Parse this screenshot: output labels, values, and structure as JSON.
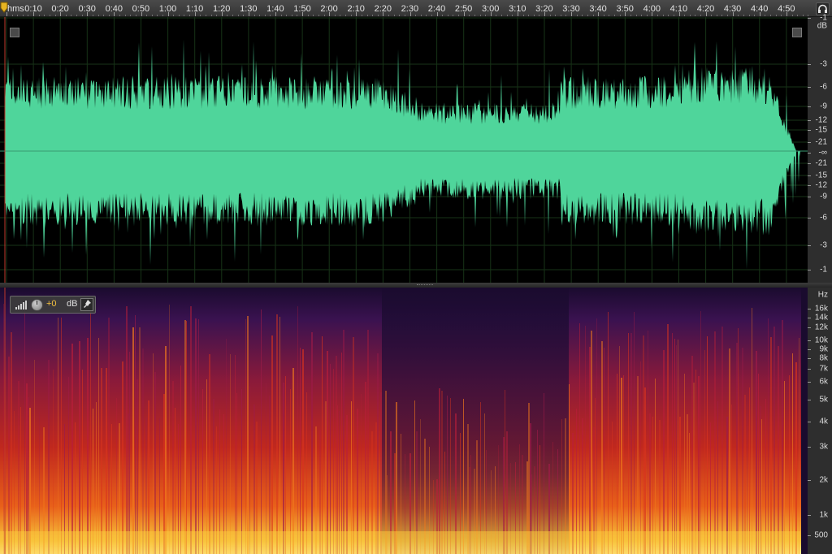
{
  "ruler": {
    "format_label": "hms",
    "ticks": [
      "0:10",
      "0:20",
      "0:30",
      "0:40",
      "0:50",
      "1:00",
      "1:10",
      "1:20",
      "1:30",
      "1:40",
      "1:50",
      "2:00",
      "2:10",
      "2:20",
      "2:30",
      "2:40",
      "2:50",
      "3:00",
      "3:10",
      "3:20",
      "3:30",
      "3:40",
      "3:50",
      "4:00",
      "4:10",
      "4:20",
      "4:30",
      "4:40",
      "4:50"
    ]
  },
  "waveform": {
    "color": "#4fd59b",
    "db_unit": "dB",
    "db_labels": [
      "-1",
      "-3",
      "-6",
      "-9",
      "-12",
      "-15",
      "-21",
      "-∞",
      "-21",
      "-15",
      "-12",
      "-9",
      "-6",
      "-3",
      "-1"
    ]
  },
  "spectrogram": {
    "hz_unit": "Hz",
    "hz_labels": [
      "16k",
      "14k",
      "12k",
      "10k",
      "9k",
      "8k",
      "7k",
      "6k",
      "5k",
      "4k",
      "3k",
      "2k",
      "1k",
      "500"
    ]
  },
  "gain_hud": {
    "gain_value": "+0",
    "gain_unit": "dB"
  },
  "icons": {
    "playhead": "playhead-marker-icon",
    "headphones": "headphones-icon",
    "pin": "pin-icon"
  }
}
